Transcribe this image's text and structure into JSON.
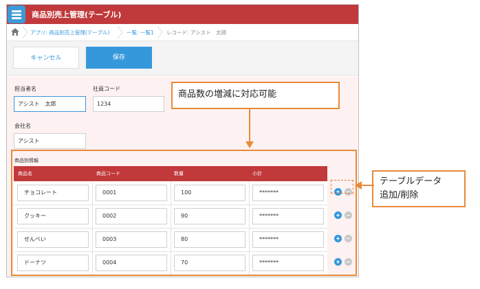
{
  "header": {
    "title": "商品別売上管理(テーブル)"
  },
  "breadcrumb": {
    "app": "アプリ: 商品別売上管理(テーブル)",
    "list": "一覧: 一覧1",
    "record": "レコード: アシスト　太郎"
  },
  "toolbar": {
    "cancel_label": "キャンセル",
    "save_label": "保存"
  },
  "form": {
    "person_label": "担当者名",
    "person_value": "アシスト　太郎",
    "employee_code_label": "社員コード",
    "employee_code_value": "1234",
    "company_label": "会社名",
    "company_value": "アシスト"
  },
  "table": {
    "section_label": "商品別情報",
    "headers": [
      "商品名",
      "商品コード",
      "数量",
      "小計"
    ],
    "rows": [
      {
        "name": "チョコレート",
        "code": "0001",
        "qty": "100",
        "subtotal": "*******"
      },
      {
        "name": "クッキー",
        "code": "0002",
        "qty": "90",
        "subtotal": "*******"
      },
      {
        "name": "せんべい",
        "code": "0003",
        "qty": "80",
        "subtotal": "*******"
      },
      {
        "name": "ドーナツ",
        "code": "0004",
        "qty": "70",
        "subtotal": "*******"
      }
    ]
  },
  "callouts": {
    "top": "商品数の増減に対応可能",
    "right_line1": "テーブルデータ",
    "right_line2": "追加/削除"
  },
  "colors": {
    "header_red": "#c1393b",
    "accent_blue": "#3598db",
    "callout_orange": "#e88a3a"
  }
}
